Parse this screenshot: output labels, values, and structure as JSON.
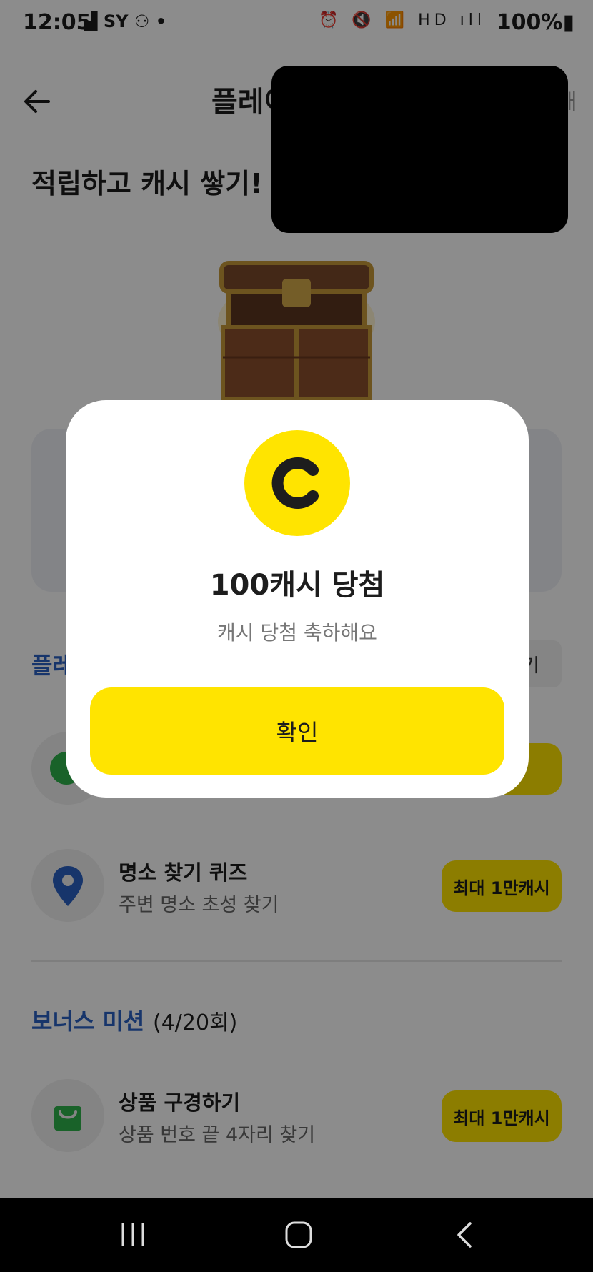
{
  "status_bar": {
    "time": "12:05",
    "left_indicators": "▟ SY ⚇ •",
    "right_indicators": "⏰ 🔇 📶 HD ıll",
    "battery": "100%▮"
  },
  "header": {
    "title": "플레이",
    "right_text": "내"
  },
  "hero": {
    "title": "적립하고 캐시 쌓기!"
  },
  "section_play": {
    "title": "플레이",
    "right_button": "기"
  },
  "missions": [
    {
      "title": "명소 찾기 퀴즈",
      "subtitle": "주변 명소 초성 찾기",
      "reward": "최대 1만캐시",
      "icon": "location-pin-icon"
    }
  ],
  "bonus": {
    "title": "보너스 미션",
    "count": "(4/20회)",
    "missions": [
      {
        "title": "상품 구경하기",
        "subtitle": "상품 번호 끝 4자리 찾기",
        "reward": "최대 1만캐시",
        "icon": "shopping-bag-icon"
      }
    ]
  },
  "modal": {
    "coin_letter": "C",
    "title": "100캐시 당첨",
    "subtitle": "캐시 당첨 축하해요",
    "confirm_label": "확인"
  },
  "nav": {
    "recent_icon": "recent-apps-icon",
    "home_icon": "home-icon",
    "back_icon": "back-icon"
  },
  "colors": {
    "accent_yellow": "#ffe400",
    "accent_blue": "#2b62c4",
    "green": "#2fb24c"
  }
}
